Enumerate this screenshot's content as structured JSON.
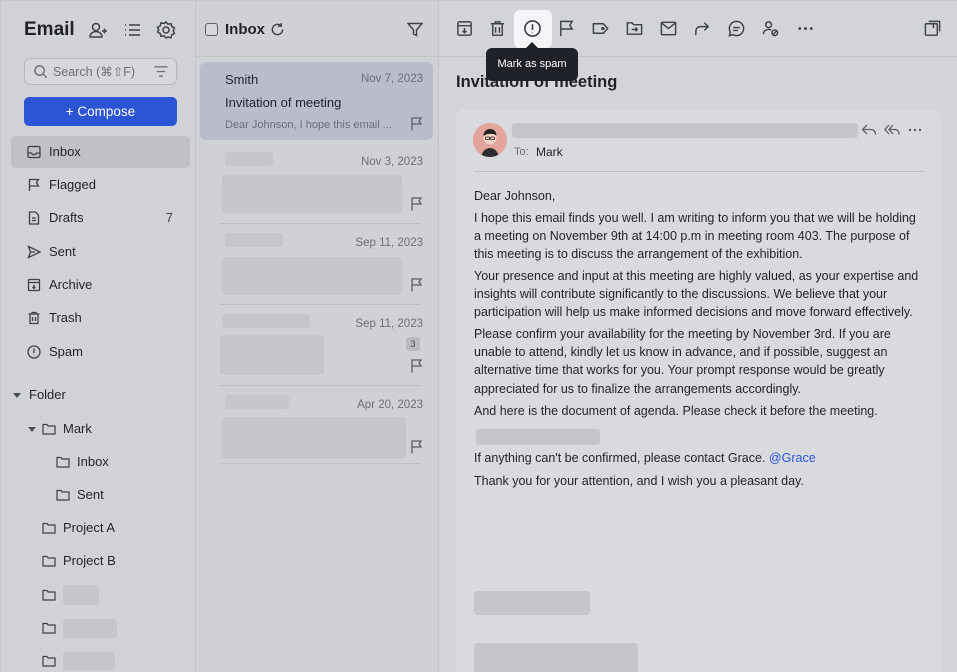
{
  "sidebar": {
    "app_title": "Email",
    "search_placeholder": "Search (⌘⇧F)",
    "compose_label": "+ Compose",
    "nav": [
      {
        "label": "Inbox",
        "icon": "inbox-icon",
        "count": ""
      },
      {
        "label": "Flagged",
        "icon": "flag-icon",
        "count": ""
      },
      {
        "label": "Drafts",
        "icon": "draft-icon",
        "count": "7"
      },
      {
        "label": "Sent",
        "icon": "send-icon",
        "count": ""
      },
      {
        "label": "Archive",
        "icon": "archive-icon",
        "count": ""
      },
      {
        "label": "Trash",
        "icon": "trash-icon",
        "count": ""
      },
      {
        "label": "Spam",
        "icon": "spam-icon",
        "count": ""
      }
    ],
    "folder_header": "Folder",
    "folders": [
      {
        "label": "Mark"
      },
      {
        "label": "Inbox"
      },
      {
        "label": "Sent"
      },
      {
        "label": "Project A"
      },
      {
        "label": "Project B"
      }
    ]
  },
  "list": {
    "title": "Inbox",
    "items": [
      {
        "sender": "Smith",
        "date": "Nov 7, 2023",
        "subject": "Invitation of meeting",
        "preview": "Dear Johnson, I hope this email ...",
        "badge": ""
      },
      {
        "sender": "",
        "date": "Nov 3, 2023",
        "subject": "",
        "preview": "",
        "badge": ""
      },
      {
        "sender": "",
        "date": "Sep 11, 2023",
        "subject": "",
        "preview": "",
        "badge": ""
      },
      {
        "sender": "",
        "date": "Sep 11, 2023",
        "subject": "",
        "preview": "",
        "badge": "3"
      },
      {
        "sender": "",
        "date": "Apr 20, 2023",
        "subject": "",
        "preview": "",
        "badge": ""
      }
    ]
  },
  "reader": {
    "tooltip": "Mark as spam",
    "subject": "Invitation of meeting",
    "to_label": "To:",
    "to_value": "Mark",
    "body": {
      "greeting": "Dear Johnson,",
      "p1": "I hope this email finds you well. I am writing to inform you that we will be holding a meeting on November 9th at 14:00 p.m in meeting room 403. The purpose of this meeting is to discuss the arrangement of the exhibition.",
      "p2": "Your presence and input at this meeting are highly valued, as your expertise and insights will contribute significantly to the discussions. We believe that your participation will help us make informed decisions and move forward effectively.",
      "p3": "Please confirm your availability for the meeting by November 3rd. If you are unable to attend, kindly let us know in advance, and if possible, suggest an alternative time that works for you. Your prompt response would be greatly appreciated for us to finalize the arrangements accordingly.",
      "p4": "And here is the document of agenda. Please check it before the meeting.",
      "p5_prefix": "If anything can't be confirmed, please contact Grace. ",
      "p5_mention": "@Grace",
      "p6": "Thank you for your attention, and I wish you a pleasant day."
    }
  },
  "colors": {
    "accent": "#2c55d6",
    "mention": "#2c55d6"
  }
}
